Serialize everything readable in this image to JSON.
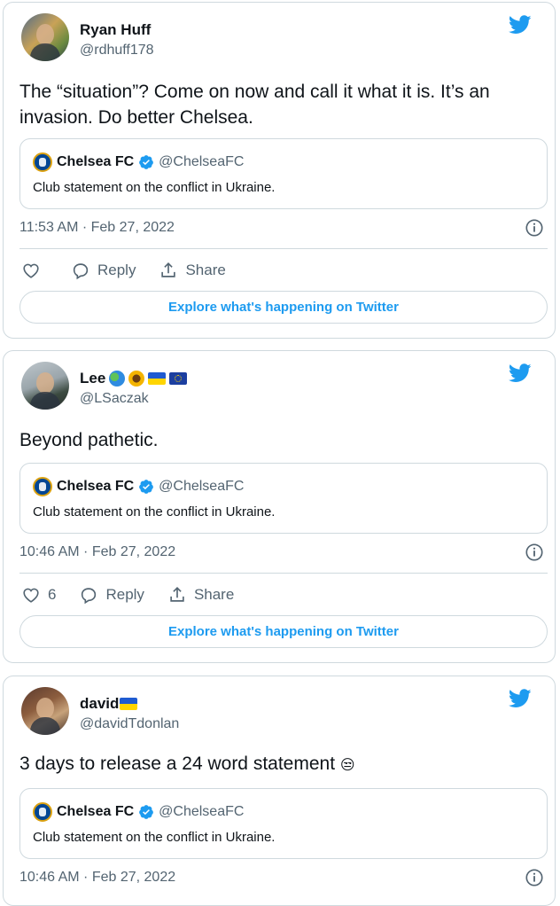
{
  "colors": {
    "twitter_blue": "#1d9bf0",
    "text": "#0f1419",
    "muted": "#536471",
    "border": "#cfd9de"
  },
  "icons": [
    "twitter-bird-icon",
    "verified-badge-icon",
    "info-icon",
    "heart-icon",
    "reply-icon",
    "share-icon"
  ],
  "tweets": [
    {
      "name": "Ryan Huff",
      "handle": "@rdhuff178",
      "text": "The “situation”? Come on now and call it what it is.  It’s an invasion.  Do better Chelsea.",
      "quote": {
        "name": "Chelsea FC",
        "handle": "@ChelseaFC",
        "text": "Club statement on the conflict in Ukraine."
      },
      "timestamp": "11:53 AM · Feb 27, 2022",
      "likes": "",
      "reply_label": "Reply",
      "share_label": "Share",
      "explore_label": "Explore what's happening on Twitter"
    },
    {
      "name": "Lee",
      "name_emojis": [
        "globe-emoji",
        "sunflower-emoji",
        "ukraine-flag",
        "eu-flag"
      ],
      "handle": "@LSaczak",
      "text": "Beyond pathetic.",
      "quote": {
        "name": "Chelsea FC",
        "handle": "@ChelseaFC",
        "text": "Club statement on the conflict in Ukraine."
      },
      "timestamp": "10:46 AM · Feb 27, 2022",
      "likes": "6",
      "reply_label": "Reply",
      "share_label": "Share",
      "explore_label": "Explore what's happening on Twitter"
    },
    {
      "name": "david",
      "name_emojis": [
        "ukraine-flag"
      ],
      "handle": "@davidTdonlan",
      "text": "3 days to release a 24 word statement",
      "text_emoji": "😒",
      "quote": {
        "name": "Chelsea FC",
        "handle": "@ChelseaFC",
        "text": "Club statement on the conflict in Ukraine."
      },
      "timestamp": "10:46 AM · Feb 27, 2022"
    }
  ]
}
